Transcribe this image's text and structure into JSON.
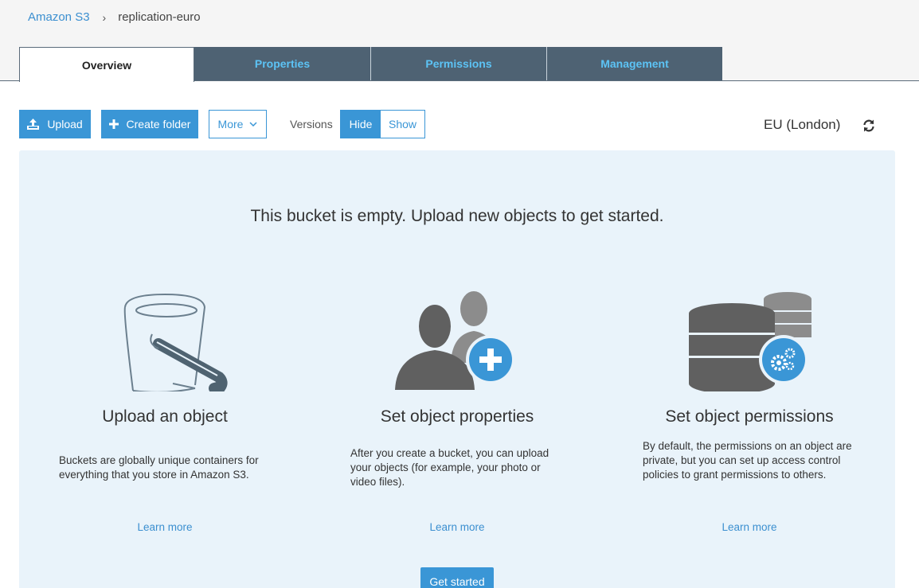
{
  "breadcrumb": {
    "root": "Amazon S3",
    "separator": "›",
    "current": "replication-euro"
  },
  "tabs": [
    {
      "label": "Overview",
      "active": true
    },
    {
      "label": "Properties",
      "active": false
    },
    {
      "label": "Permissions",
      "active": false
    },
    {
      "label": "Management",
      "active": false
    }
  ],
  "toolbar": {
    "upload_label": "Upload",
    "create_folder_label": "Create folder",
    "more_label": "More",
    "versions_label": "Versions",
    "hide_label": "Hide",
    "show_label": "Show",
    "region": "EU (London)"
  },
  "empty_state": {
    "title": "This bucket is empty. Upload new objects to get started.",
    "cards": [
      {
        "heading": "Upload an object",
        "description": "Buckets are globally unique containers for everything that you store in Amazon S3.",
        "link": "Learn more",
        "icon": "bucket-icon"
      },
      {
        "heading": "Set object properties",
        "description": "After you create a bucket, you can upload your objects (for example, your photo or video files).",
        "link": "Learn more",
        "icon": "users-add-icon"
      },
      {
        "heading": "Set object permissions",
        "description": "By default, the permissions on an object are private, but you can set up access control policies to grant permissions to others.",
        "link": "Learn more",
        "icon": "database-settings-icon"
      }
    ],
    "cta_label": "Get started"
  },
  "colors": {
    "accent": "#3a96d6",
    "tab_bg": "#4e6273",
    "tab_text": "#5cc3f5",
    "panel_bg": "#e9f3fa"
  }
}
